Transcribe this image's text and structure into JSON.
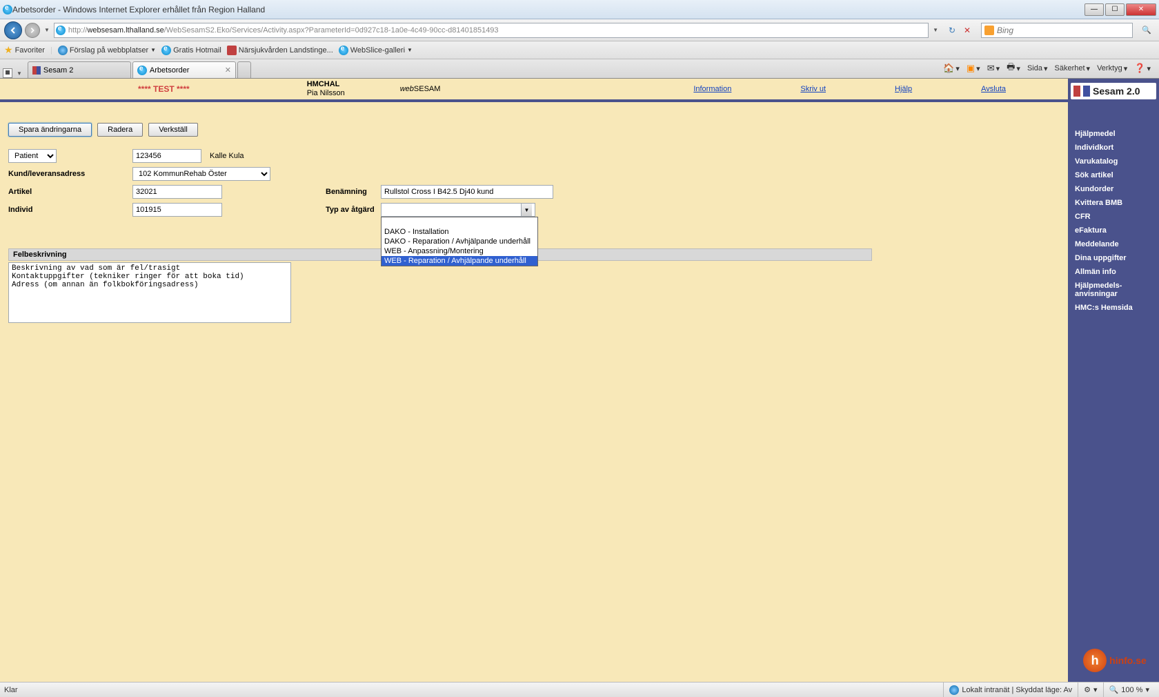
{
  "window": {
    "title": "Arbetsorder - Windows Internet Explorer erhållet från Region Halland"
  },
  "address": {
    "prefix": "http://",
    "host": "websesam.lthalland.se",
    "path": "/WebSesamS2.Eko/Services/Activity.aspx?ParameterId=0d927c18-1a0e-4c49-90cc-d81401851493"
  },
  "search": {
    "placeholder": "Bing"
  },
  "favorites": {
    "label": "Favoriter",
    "items": [
      "Förslag på webbplatser",
      "Gratis Hotmail",
      "Närsjukvården Landstinge...",
      "WebSlice-galleri"
    ]
  },
  "tabs": [
    {
      "label": "Sesam 2"
    },
    {
      "label": "Arbetsorder"
    }
  ],
  "toolbar_right": {
    "sida": "Sida",
    "sakerhet": "Säkerhet",
    "verktyg": "Verktyg"
  },
  "app_header": {
    "test": "**** TEST ****",
    "code": "HMCHAL",
    "user": "Pia Nilsson",
    "brand_web": "web",
    "brand_sesam": "SESAM",
    "links": {
      "information": "Information",
      "skriv_ut": "Skriv ut",
      "hjalp": "Hjälp",
      "avsluta": "Avsluta"
    }
  },
  "form": {
    "buttons": {
      "save": "Spara ändringarna",
      "delete": "Radera",
      "execute": "Verkställ"
    },
    "patient_label": "Patient",
    "patient_id": "123456",
    "patient_name": "Kalle Kula",
    "kund_label": "Kund/leveransadress",
    "kund_value": "102 KommunRehab Öster",
    "artikel_label": "Artikel",
    "artikel_value": "32021",
    "individ_label": "Individ",
    "individ_value": "101915",
    "benamning_label": "Benämning",
    "benamning_value": "Rullstol Cross I B42.5 Dj40 kund",
    "atgard_label": "Typ av åtgärd",
    "atgard_options": [
      "",
      "DAKO - Installation",
      "DAKO - Reparation / Avhjälpande underhåll",
      "WEB - Anpassning/Montering",
      "WEB - Reparation / Avhjälpande underhåll"
    ],
    "felbeskrivning_label": "Felbeskrivning",
    "felbeskrivning_text": "Beskrivning av vad som är fel/trasigt\nKontaktuppgifter (tekniker ringer för att boka tid)\nAdress (om annan än folkbokföringsadress)"
  },
  "sidebar": {
    "logo": "Sesam 2.0",
    "links": [
      "Hjälpmedel",
      "Individkort",
      "Varukatalog",
      "Sök artikel",
      "Kundorder",
      "Kvittera BMB",
      "CFR",
      "eFaktura",
      "Meddelande",
      "Dina uppgifter",
      "Allmän info",
      "Hjälpmedels-anvisningar",
      "HMC:s Hemsida"
    ]
  },
  "hinfo": "hinfo.se",
  "status": {
    "left": "Klar",
    "zone": "Lokalt intranät | Skyddat läge: Av",
    "zoom": "100 %"
  }
}
